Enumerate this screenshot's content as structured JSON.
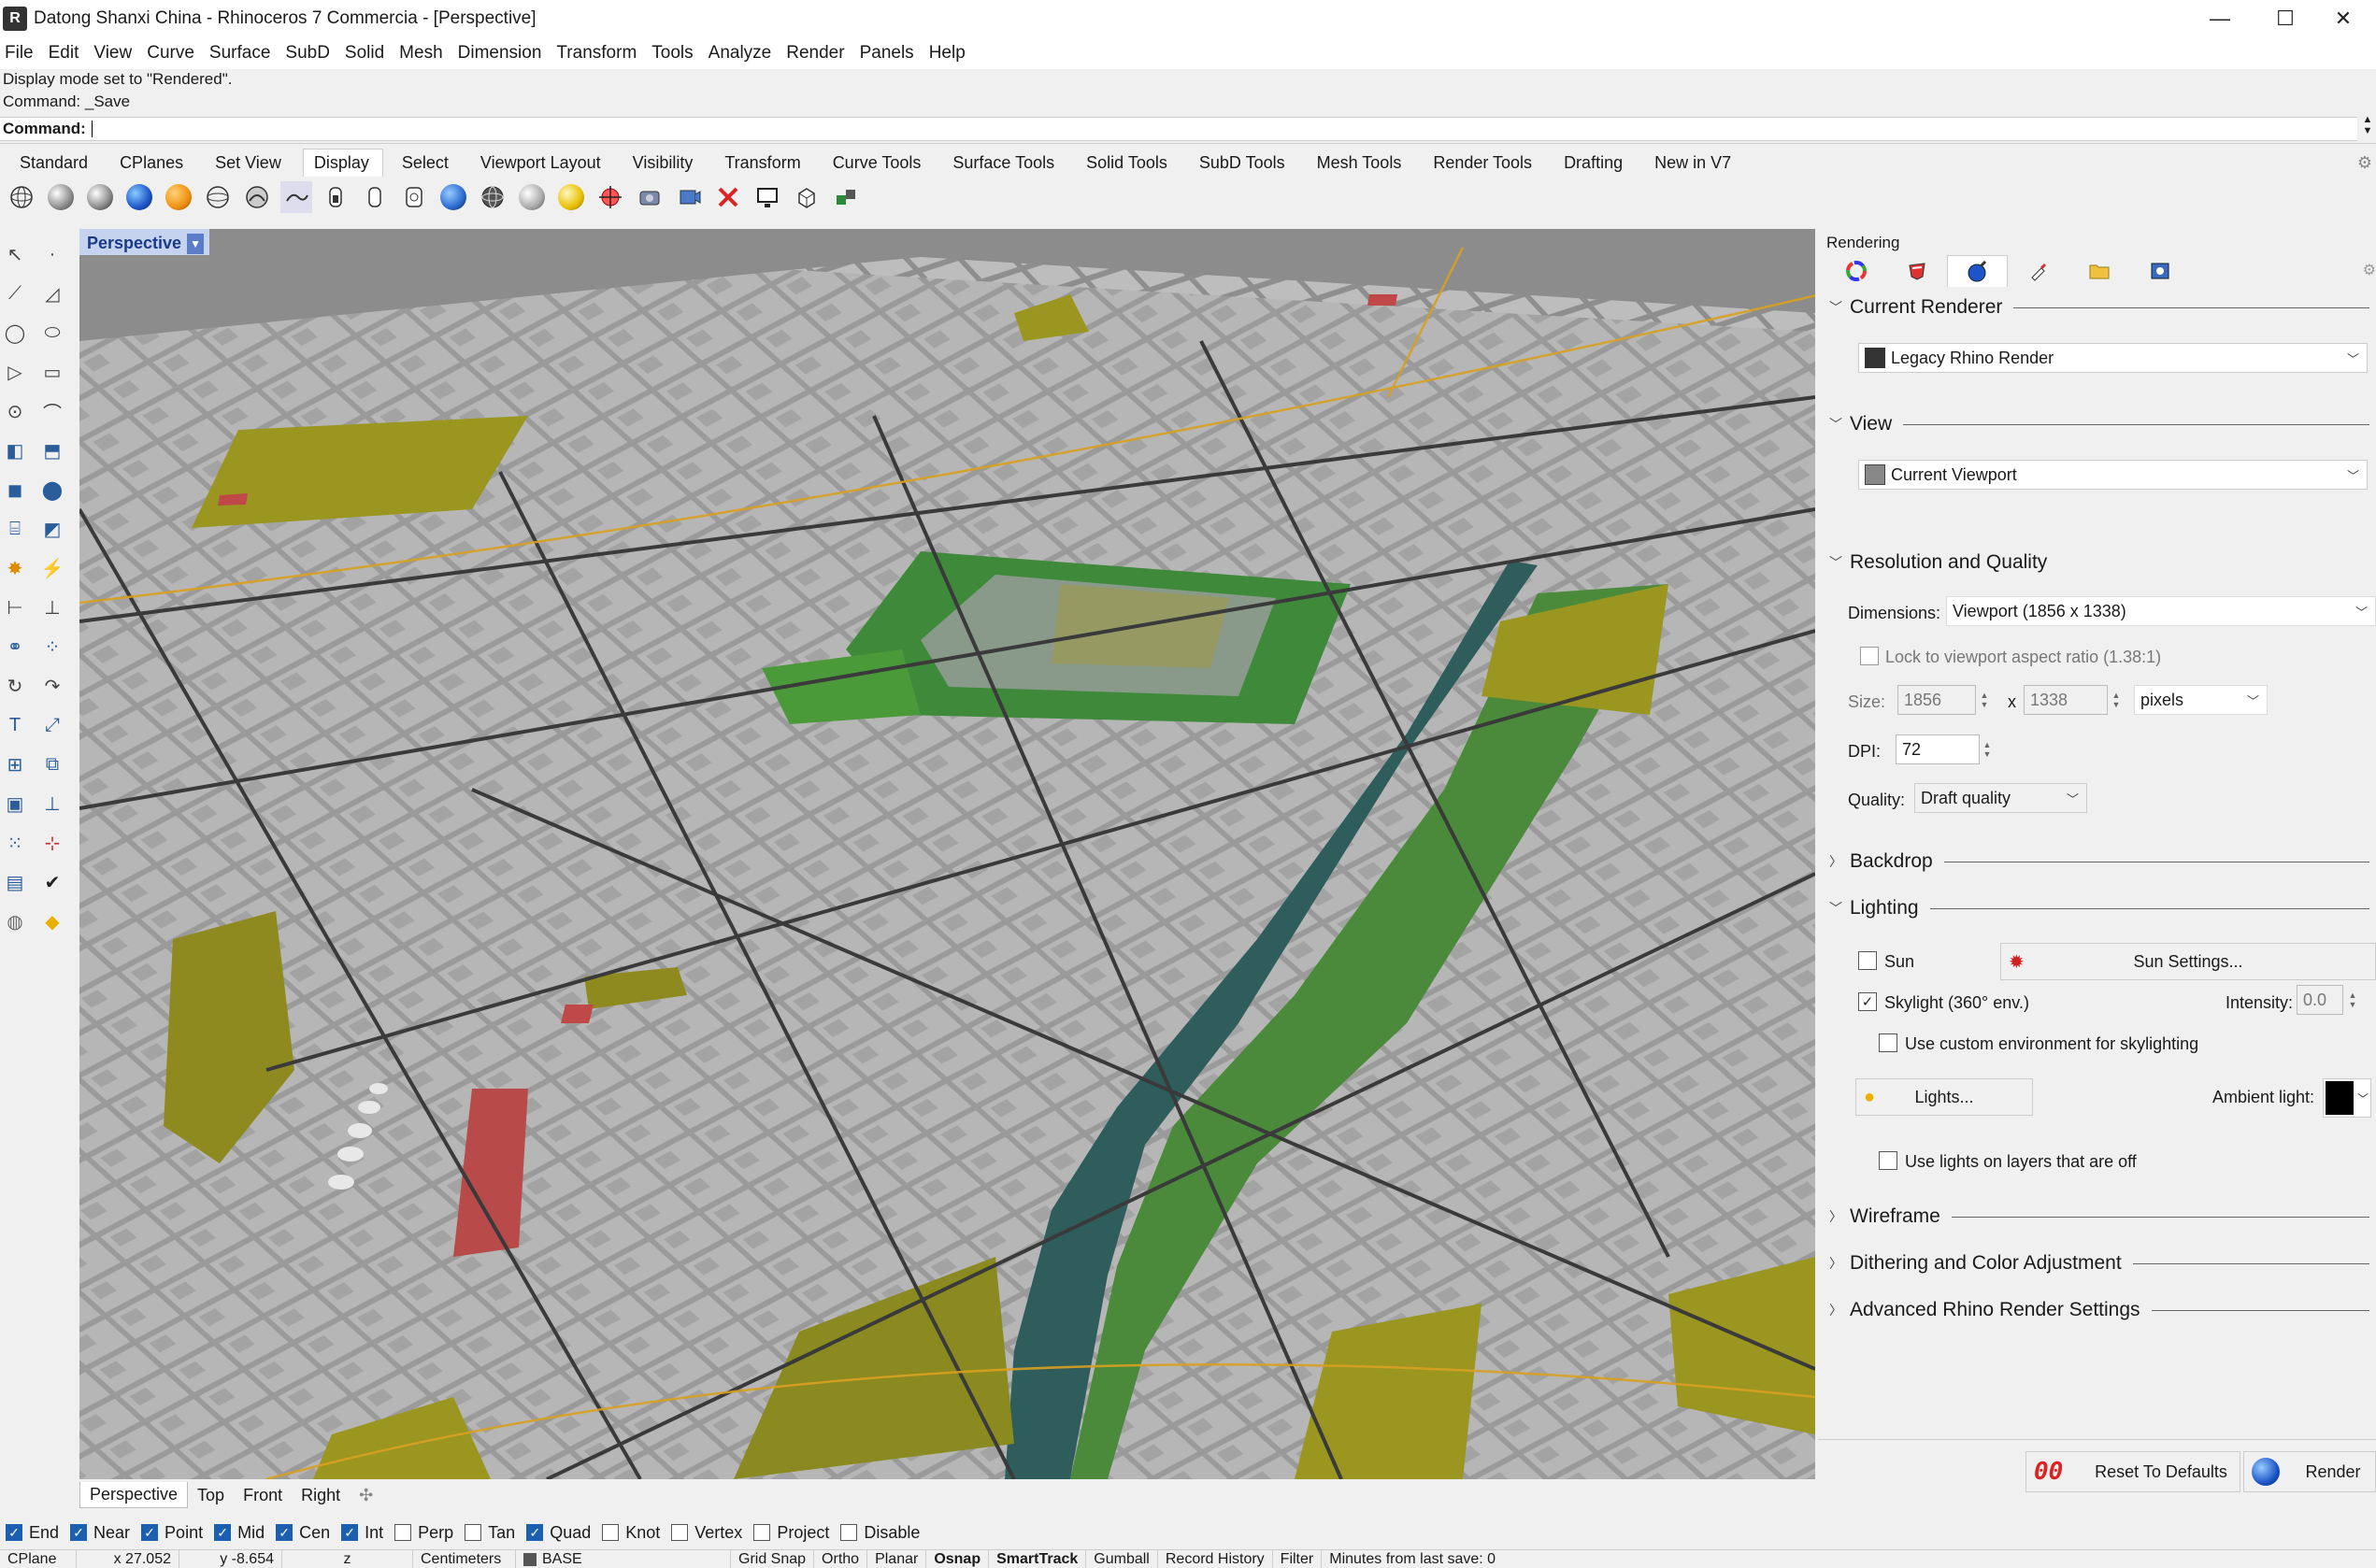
{
  "window": {
    "title": "Datong Shanxi China - Rhinoceros 7 Commercia - [Perspective]",
    "minimize": "—",
    "maximize": "☐",
    "close": "✕"
  },
  "menu": [
    "File",
    "Edit",
    "View",
    "Curve",
    "Surface",
    "SubD",
    "Solid",
    "Mesh",
    "Dimension",
    "Transform",
    "Tools",
    "Analyze",
    "Render",
    "Panels",
    "Help"
  ],
  "command": {
    "history": [
      "Display mode set to \"Rendered\".",
      "Command: _Save"
    ],
    "prompt": "Command:"
  },
  "toolbar_tabs": [
    "Standard",
    "CPlanes",
    "Set View",
    "Display",
    "Select",
    "Viewport Layout",
    "Visibility",
    "Transform",
    "Curve Tools",
    "Surface Tools",
    "Solid Tools",
    "SubD Tools",
    "Mesh Tools",
    "Render Tools",
    "Drafting",
    "New in V7"
  ],
  "active_toolbar_tab": "Display",
  "display_icons": [
    "wireframe-mode-icon",
    "shaded-mode-icon",
    "rendered-mode-icon",
    "ghosted-mode-icon",
    "xray-mode-icon",
    "technical-mode-icon",
    "artistic-mode-icon",
    "pen-mode-icon",
    "arctic-mode-icon",
    "raytraced-mode-icon",
    "monochrome-mode-icon",
    "shade-object-icon",
    "shade-all-icon",
    "set-object-display-icon",
    "light-icon",
    "sun-icon",
    "cplane-icon",
    "camera-icon",
    "zoom-icon",
    "disable-icon",
    "screen-icon",
    "box-edit-icon",
    "clipping-plane-icon"
  ],
  "viewport": {
    "name": "Perspective",
    "tabs": [
      "Perspective",
      "Top",
      "Front",
      "Right"
    ],
    "active_tab": "Perspective"
  },
  "osnaps": [
    {
      "label": "End",
      "checked": true
    },
    {
      "label": "Near",
      "checked": true
    },
    {
      "label": "Point",
      "checked": true
    },
    {
      "label": "Mid",
      "checked": true
    },
    {
      "label": "Cen",
      "checked": true
    },
    {
      "label": "Int",
      "checked": true
    },
    {
      "label": "Perp",
      "checked": false
    },
    {
      "label": "Tan",
      "checked": false
    },
    {
      "label": "Quad",
      "checked": true
    },
    {
      "label": "Knot",
      "checked": false
    },
    {
      "label": "Vertex",
      "checked": false
    },
    {
      "label": "Project",
      "checked": false
    },
    {
      "label": "Disable",
      "checked": false
    }
  ],
  "status": {
    "cplane": "CPlane",
    "x": "x 27.052",
    "y": "y -8.654",
    "z": "z",
    "units": "Centimeters",
    "layer": "BASE",
    "grid_snap": "Grid Snap",
    "ortho": "Ortho",
    "planar": "Planar",
    "osnap": "Osnap",
    "smarttrack": "SmartTrack",
    "gumball": "Gumball",
    "record_history": "Record History",
    "filter": "Filter",
    "last_save": "Minutes from last save: 0"
  },
  "panel": {
    "title": "Rendering",
    "tabs": [
      "color-wheel-icon",
      "material-icon",
      "render-settings-icon",
      "dropper-icon",
      "folder-icon",
      "render-window-icon"
    ],
    "current_renderer": {
      "header": "Current Renderer",
      "value": "Legacy Rhino Render"
    },
    "view": {
      "header": "View",
      "value": "Current Viewport"
    },
    "resolution": {
      "header": "Resolution and Quality",
      "dimensions_label": "Dimensions:",
      "dimensions_value": "Viewport (1856 x 1338)",
      "lock_label": "Lock to viewport aspect ratio (1.38:1)",
      "lock_checked": false,
      "size_label": "Size:",
      "width": "1856",
      "x_sep": "x",
      "height": "1338",
      "unit": "pixels",
      "dpi_label": "DPI:",
      "dpi": "72",
      "quality_label": "Quality:",
      "quality": "Draft quality"
    },
    "backdrop": {
      "header": "Backdrop"
    },
    "lighting": {
      "header": "Lighting",
      "sun_label": "Sun",
      "sun_checked": false,
      "sun_settings": "Sun Settings...",
      "skylight_label": "Skylight (360° env.)",
      "skylight_checked": true,
      "intensity_label": "Intensity:",
      "intensity": "0.0",
      "custom_env_label": "Use custom environment for skylighting",
      "custom_env_checked": false,
      "lights_button": "Lights...",
      "ambient_label": "Ambient light:",
      "ambient_color": "#000000",
      "layers_off_label": "Use lights on layers that are off",
      "layers_off_checked": false
    },
    "wireframe": {
      "header": "Wireframe"
    },
    "dithering": {
      "header": "Dithering and Color Adjustment"
    },
    "advanced": {
      "header": "Advanced Rhino Render Settings"
    },
    "reset_button": "Reset To Defaults",
    "render_button": "Render"
  }
}
